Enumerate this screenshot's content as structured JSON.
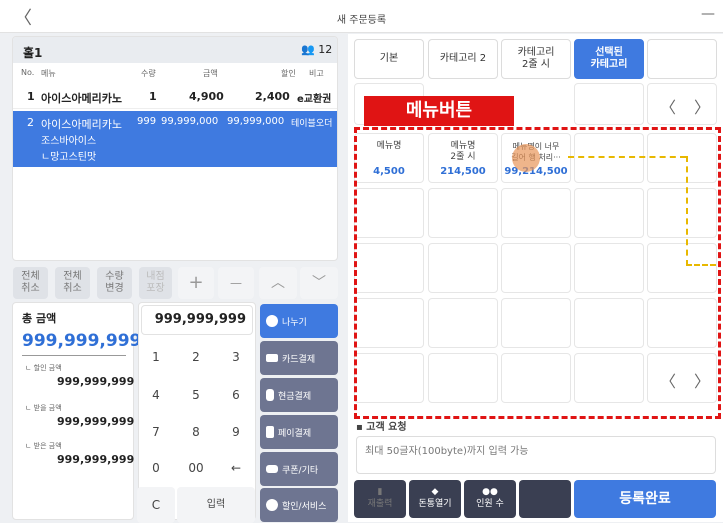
{
  "window": {
    "title": "새 주문등록",
    "back": "〈",
    "minimize": "—"
  },
  "order": {
    "table_name": "홀1",
    "people_icon": "people-icon",
    "people_count": "12",
    "columns": {
      "no": "No.",
      "menu": "메뉴",
      "qty": "수량",
      "amount": "금액",
      "discount": "할인",
      "note": "비고"
    },
    "rows": [
      {
        "no": "1",
        "menu": "아이스아메리카노",
        "qty": "1",
        "amount": "4,900",
        "discount": "2,400",
        "note": "e교환권",
        "sub": [
          "",
          ""
        ]
      },
      {
        "no": "2",
        "menu": "아이스아메리카노",
        "qty": "999",
        "amount": "99,999,000",
        "discount": "99,999,000",
        "note": "테이블오더",
        "sub": [
          "조스바아이스",
          "ㄴ망고스틴맛"
        ]
      }
    ]
  },
  "keys": {
    "cancel_all": "전체\n취소",
    "cancel_all2": "전체\n취소",
    "qty_change": "수량\n변경",
    "takeout": "내점\n포장",
    "plus": "+",
    "minus": "—",
    "up": "︿",
    "down": "﹀"
  },
  "totals": {
    "label": "총 금액",
    "total": "999,999,999",
    "disc_label": "ㄴ 할인 금액",
    "disc": "999,999,999",
    "recv_label": "ㄴ 받을 금액",
    "recv": "999,999,999",
    "got_label": "ㄴ 받은 금액",
    "got": "999,999,999"
  },
  "numpad": {
    "display": "999,999,999",
    "keys": [
      "1",
      "2",
      "3",
      "4",
      "5",
      "6",
      "7",
      "8",
      "9",
      "0",
      "00",
      "←"
    ],
    "clear": "C",
    "enter": "입력"
  },
  "payments": [
    {
      "label": "나누기",
      "color": "#3f7ae0"
    },
    {
      "label": "카드결제",
      "color": "#6e7591"
    },
    {
      "label": "현금결제",
      "color": "#6e7591"
    },
    {
      "label": "페이결제",
      "color": "#6e7591"
    },
    {
      "label": "쿠폰/기타",
      "color": "#6e7591"
    },
    {
      "label": "할인/서비스",
      "color": "#6e7591"
    }
  ],
  "categories": [
    "기본",
    "카테고리 2",
    "카테고리\n2줄 시",
    "선택된\n카테고리",
    ""
  ],
  "pager": {
    "prev": "〈",
    "next": "〉"
  },
  "annotation": {
    "label": "메뉴버튼"
  },
  "menus": [
    {
      "name": "메뉴명",
      "price": "4,500"
    },
    {
      "name": "메뉴명\n2줄 시",
      "price": "214,500"
    },
    {
      "name": "메뉴명이 너무\n길어 행 처리···",
      "price": "99,214,500"
    }
  ],
  "customer_request": {
    "label": "고객 요청",
    "placeholder": "최대 50글자(100byte)까지 입력 가능"
  },
  "bottom": {
    "reprint": "재출력",
    "drawer": "돈통열기",
    "people": "인원 수",
    "complete": "등록완료"
  }
}
